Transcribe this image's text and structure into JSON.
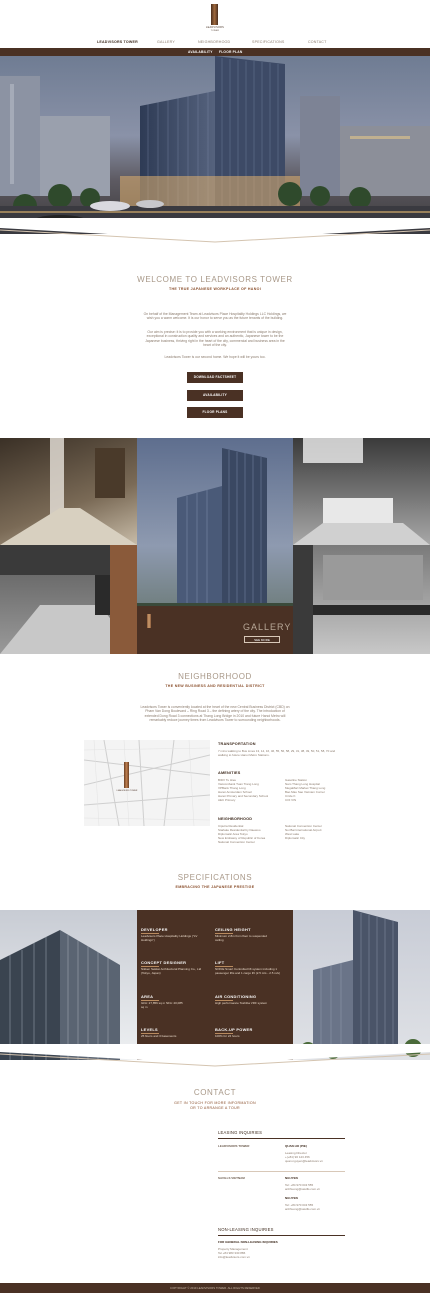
{
  "brand": {
    "logo_line1": "LEADVISORS",
    "logo_line2": "TOWER"
  },
  "nav": {
    "items": [
      "LEADVISORS TOWER",
      "GALLERY",
      "NEIGHBORHOOD",
      "SPECIFICATIONS",
      "CONTACT"
    ]
  },
  "subnav": {
    "items": [
      "AVAILABILITY",
      "FLOOR PLAN"
    ]
  },
  "welcome": {
    "title": "WELCOME TO LEADVISORS TOWER",
    "subtitle": "THE TRUE JAPANESE WORKPLACE OF HANOI",
    "p1": "On behalf of the Management Team at Leadvisors Place Hospitality Holdings LLC Holdings, we wish you a warm welcome. It is our honor to serve you as the future tenants of the building.",
    "p2": "Our aim is precise: it is to provide you with a working environment that is unique in design, exceptional in construction quality and services and an authentic, Japanese tower to be the Japanese business, thriving right in the heart of the city, commercial and business area in the heart of the city.",
    "p3": "Leadvisors Tower is our second home. We hope it will be yours too.",
    "buttons": [
      "DOWNLOAD FACTSHEET",
      "AVAILABILITY",
      "FLOOR PLANS"
    ]
  },
  "gallery": {
    "title": "GALLERY",
    "button": "SEE MORE"
  },
  "neighborhood": {
    "title": "NEIGHBORHOOD",
    "subtitle": "THE NEW BUSINESS AND RESIDENTIAL DISTRICT",
    "intro": "Leadvisors Tower is conveniently located at the heart of the new Central Business District (CBD) on Pham Van Dong Boulevard – Ring Road 3 – the defining artery of the city. The introduction of extended Dong Road 3 connections at Thang Long Bridge in 2010 and future Hanoi Metro will remarkably reduce journey times from Leadvisors Tower to surrounding neighborhoods.",
    "transport_h": "TRANSPORTATION",
    "transport": "7 mins walking to Bus Lines 13, 14, 16, 46, 55, 56, 58, 29, 31, 38, 49, 50, 51, 58, 70 and walking to future Hanoi Metro Stations.",
    "amenities_h": "AMENITIES",
    "amen_left": [
      "BIDV Tu Hieu",
      "Vietcombank Tuan Trang Long",
      "VPBank Thang Long",
      "Hanoi Amsterdam School",
      "Hanoi Primary and Secondary School",
      "AEC Primary"
    ],
    "amen_right": [
      "Gasoline Station",
      "Nam Thang Long Hospital",
      "MegaMart Market Thang Long",
      "Bao Mau Sao Vietnam Corner",
      "Circle K",
      "COI VIN"
    ],
    "neigh_h": "NEIGHBORHOOD",
    "neigh_left": [
      "Ciputra Residential",
      "Starlake Residential by Daewoo",
      "Diplomatic Area Tokyo",
      "New Embassy of Republic of Korea",
      "National Convention Center"
    ],
    "neigh_right": [
      "National Convention Center",
      "Noi Bai International Airport",
      "West Lake",
      "Diplomatic City"
    ],
    "map_logo": "LEADVISORS TOWER"
  },
  "specs": {
    "title": "SPECIFICATIONS",
    "subtitle": "EMBRACING THE JAPANESE PRESTIGE",
    "items": [
      {
        "label": "DEVELOPER",
        "value": "Leadvisors Place Hospitality Holdings (\"LV Holdings\")"
      },
      {
        "label": "CEILING HEIGHT",
        "value": "Minimum 2.8m from floor to suspended ceiling"
      },
      {
        "label": "CONCEPT DESIGNER",
        "value": "Nikken Sekkei Architectural Planning Co., Ltd (Tokyo, Japan)"
      },
      {
        "label": "LIFT",
        "value": "NOKIE Smart Controlled lift system including 1 passenger lifts and 1 cargo lift (2.5 m/s - 2.5 m/s)"
      },
      {
        "label": "AREA",
        "value": "GFA: 27,856 sq m NFA: 20,085 sq m"
      },
      {
        "label": "AIR CONDITIONING",
        "value": "High performance Toshiba VRF system"
      },
      {
        "label": "LEVELS",
        "value": "25 floors and 3 basements"
      },
      {
        "label": "BACK-UP POWER",
        "value": "100% for 24 hours"
      }
    ]
  },
  "contact": {
    "title": "CONTACT",
    "sub1": "GET IN TOUCH FOR MORE INFORMATION",
    "sub2": "OR TO ARRANGE A TOUR",
    "leasing_h": "LEASING INQUIRIES",
    "row1_left": "LEADVISORS TOWER",
    "row1_name": "QUAN HO (PIE)",
    "row1_lines": [
      "Leasing Director",
      "+(+84) 90 123 456",
      "quan.nguyen@leadvisors.vn"
    ],
    "row2_left": "SAVILLS VIETNAM",
    "row2_a_name": "NGUYEN",
    "row2_a_lines": [
      "Tel: +84 970 043 555",
      "anhhuong@savills.com.vn"
    ],
    "row2_b_name": "NGUYEN",
    "row2_b_lines": [
      "Tel: +84 970 043 555",
      "anhhuong@savills.com.vn"
    ],
    "non_h": "NON-LEASING INQUIRIES",
    "non_sub": "FOR GENERAL NON-LEASING INQUIRIES",
    "non_lines": [
      "Property Management",
      "Tel +84 983 330 886",
      "info@leadvisors.com.vn"
    ]
  },
  "footer": {
    "text": "COPYRIGHT © 2019 LEADVISORS TOWER. ALL RIGHTS RESERVED"
  },
  "colors": {
    "brand": "#4a3124",
    "accent": "#8a4f2c",
    "text": "#8a7a6c"
  }
}
